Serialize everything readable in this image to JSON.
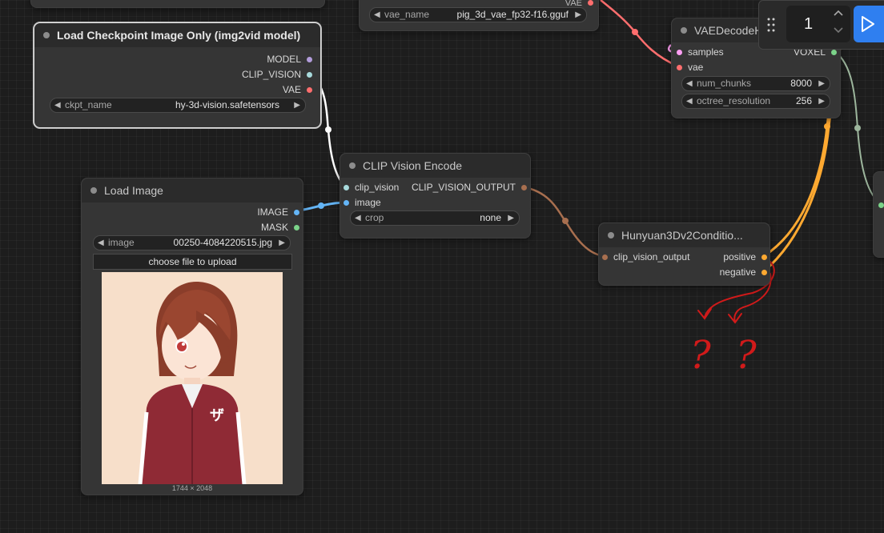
{
  "nodes": {
    "checkpoint": {
      "title": "Load Checkpoint Image Only (img2vid model)",
      "outputs": [
        "MODEL",
        "CLIP_VISION",
        "VAE"
      ],
      "widget": {
        "label": "ckpt_name",
        "value": "hy-3d-vision.safetensors"
      }
    },
    "vae_loader": {
      "output_partial": "VAE",
      "widget": {
        "label": "vae_name",
        "value": "pig_3d_vae_fp32-f16.gguf"
      }
    },
    "vae_decode": {
      "title": "VAEDecodeH",
      "inputs": [
        "samples",
        "vae"
      ],
      "output": "VOXEL",
      "widgets": [
        {
          "label": "num_chunks",
          "value": "8000"
        },
        {
          "label": "octree_resolution",
          "value": "256"
        }
      ]
    },
    "load_image": {
      "title": "Load Image",
      "outputs": [
        "IMAGE",
        "MASK"
      ],
      "widget": {
        "label": "image",
        "value": "00250-4084220515.jpg"
      },
      "upload_label": "choose file to upload",
      "image_caption": "1744 × 2048"
    },
    "clip_vision_encode": {
      "title": "CLIP Vision Encode",
      "inputs": [
        "clip_vision",
        "image"
      ],
      "output": "CLIP_VISION_OUTPUT",
      "widget": {
        "label": "crop",
        "value": "none"
      }
    },
    "hunyuan_cond": {
      "title": "Hunyuan3Dv2Conditio...",
      "input": "clip_vision_output",
      "outputs": [
        "positive",
        "negative"
      ]
    }
  },
  "annotation": {
    "text": "? ?"
  },
  "toolbar": {
    "batch_count": "1"
  },
  "colors": {
    "clip_vision": "#a8dadc",
    "image": "#64b5f6",
    "vae": "#ff6e6e",
    "model": "#b39ddb",
    "conditioning": "#ffa931",
    "voxel": "#7bd389",
    "clip_vision_output": "#a86f4f",
    "annotation": "#d11a1a",
    "accent": "#2f7ff0"
  }
}
